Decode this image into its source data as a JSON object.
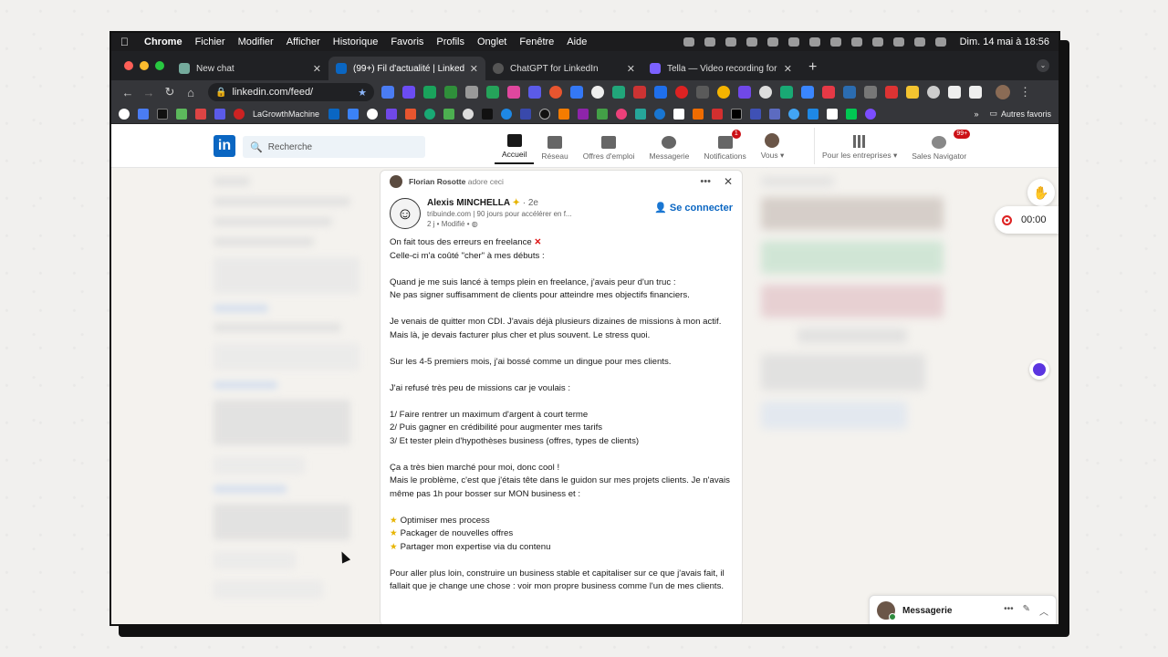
{
  "menubar": {
    "app": "Chrome",
    "items": [
      "Fichier",
      "Modifier",
      "Afficher",
      "Historique",
      "Favoris",
      "Profils",
      "Onglet",
      "Fenêtre",
      "Aide"
    ],
    "clock": "Dim. 14 mai à 18:56"
  },
  "tabs": [
    {
      "title": "New chat",
      "color": "#74aa9c"
    },
    {
      "title": "(99+) Fil d'actualité | LinkedIn",
      "color": "#0a66c2"
    },
    {
      "title": "ChatGPT for LinkedIn",
      "color": "#555"
    },
    {
      "title": "Tella — Video recording for wo",
      "color": "#7b61ff"
    }
  ],
  "address": {
    "url": "linkedin.com/feed/"
  },
  "bookmarks": {
    "label": "LaGrowthMachine",
    "other": "Autres favoris"
  },
  "linkedin": {
    "search_placeholder": "Recherche",
    "nav": {
      "home": "Accueil",
      "network": "Réseau",
      "jobs": "Offres d'emploi",
      "messaging": "Messagerie",
      "notifications": "Notifications",
      "notifications_badge": "1",
      "me": "Vous ▾",
      "business": "Pour les entreprises ▾",
      "sales": "Sales Navigator",
      "sales_badge": "99+"
    },
    "post": {
      "reaction_actor": "Florian Rosotte",
      "reaction_text": "adore ceci",
      "author": "Alexis MINCHELLA",
      "degree": "· 2e",
      "headline": "tribuinde.com | 90 jours pour accélérer en f...",
      "meta": "2 j • Modifié •",
      "connect": "Se connecter",
      "lines": [
        "On fait tous des erreurs en freelance",
        "Celle-ci m'a coûté \"cher\" à mes débuts :",
        "",
        "Quand je me suis lancé à temps plein en freelance, j'avais peur d'un truc :",
        "Ne pas signer suffisamment de clients pour atteindre mes objectifs financiers.",
        "",
        "Je venais de quitter mon CDI. J'avais déjà plusieurs dizaines de missions à mon actif. Mais là, je devais facturer plus cher et plus souvent. Le stress quoi.",
        "",
        "Sur les 4-5 premiers mois, j'ai bossé comme un dingue pour mes clients.",
        "",
        "J'ai refusé très peu de missions car je voulais :",
        "",
        "1/ Faire rentrer un maximum d'argent à court terme",
        "2/ Puis gagner en crédibilité pour augmenter mes tarifs",
        "3/ Et tester plein d'hypothèses business (offres, types de clients)",
        "",
        "Ça a très bien marché pour moi, donc cool !",
        "Mais le problème, c'est que j'étais tête dans le guidon sur mes projets clients. Je n'avais même pas 1h pour bosser sur MON business et :",
        ""
      ],
      "bullets": [
        "Optimiser mes process",
        "Packager de nouvelles offres",
        "Partager mon expertise via du contenu"
      ],
      "closing": "Pour aller plus loin, construire un business stable et capitaliser sur ce que j'avais fait, il fallait que je change une chose : voir mon propre business comme l'un de mes clients."
    },
    "messaging": "Messagerie"
  },
  "recorder": {
    "time": "00:00"
  }
}
